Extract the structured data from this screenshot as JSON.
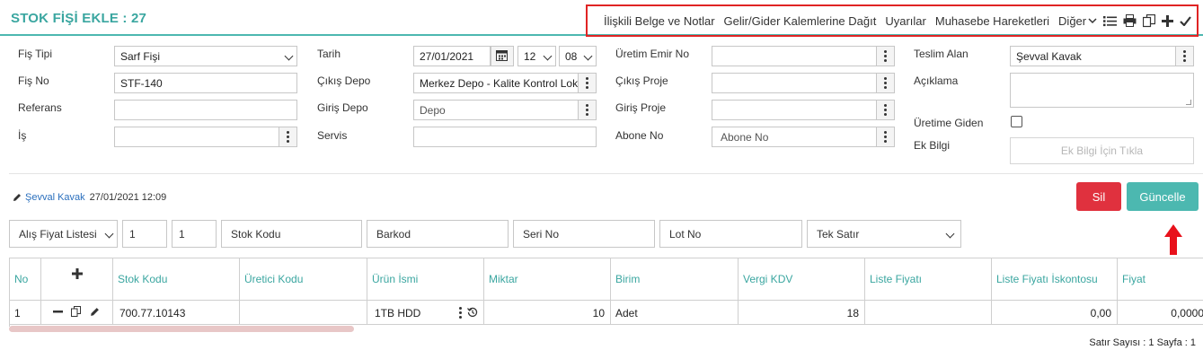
{
  "header": {
    "title": "STOK FİŞİ EKLE : 27",
    "menu": [
      "İlişkili Belge ve Notlar",
      "Gelir/Gider Kalemlerine Dağıt",
      "Uyarılar",
      "Muhasebe Hareketleri",
      "Diğer"
    ],
    "icons": [
      "chevron-down-icon",
      "list-icon",
      "print-icon",
      "copy-icon",
      "plus-icon",
      "check-icon"
    ]
  },
  "form": {
    "fis_tipi": {
      "label": "Fiş Tipi",
      "value": "Sarf Fişi"
    },
    "fis_no": {
      "label": "Fiş No",
      "value": "STF-140"
    },
    "referans": {
      "label": "Referans",
      "value": ""
    },
    "is": {
      "label": "İş",
      "value": ""
    },
    "tarih": {
      "label": "Tarih",
      "date": "27/01/2021",
      "hour": "12",
      "minute": "08"
    },
    "cikis_depo": {
      "label": "Çıkış Depo",
      "value": "Merkez Depo - Kalite Kontrol Lokasyonu"
    },
    "giris_depo": {
      "label": "Giriş Depo",
      "placeholder": "Depo"
    },
    "servis": {
      "label": "Servis",
      "value": ""
    },
    "uretim_emir_no": {
      "label": "Üretim Emir No",
      "value": ""
    },
    "cikis_proje": {
      "label": "Çıkış Proje",
      "value": ""
    },
    "giris_proje": {
      "label": "Giriş Proje",
      "value": ""
    },
    "abone_no": {
      "label": "Abone No",
      "placeholder": "Abone No"
    },
    "teslim_alan": {
      "label": "Teslim Alan",
      "value": "Şevval Kavak"
    },
    "aciklama": {
      "label": "Açıklama",
      "value": ""
    },
    "uretime_giden": {
      "label": "Üretime Giden",
      "checked": false
    },
    "ek_bilgi": {
      "label": "Ek Bilgi",
      "button": "Ek Bilgi İçin Tıkla"
    }
  },
  "meta": {
    "user": "Şevval Kavak",
    "timestamp": "27/01/2021 12:09"
  },
  "actions": {
    "delete": "Sil",
    "update": "Güncelle"
  },
  "filters": {
    "price_list": "Alış Fiyat Listesi",
    "qty1": "1",
    "qty2": "1",
    "stock_code": "Stok Kodu",
    "barcode": "Barkod",
    "serial_no": "Seri No",
    "lot_no": "Lot No",
    "mode": "Tek Satır"
  },
  "table": {
    "columns": [
      "No",
      "+",
      "Stok Kodu",
      "Üretici Kodu",
      "Ürün İsmi",
      "Miktar",
      "Birim",
      "Vergi KDV",
      "Liste Fiyatı",
      "Liste Fiyatı İskontosu",
      "Fiyat"
    ],
    "rows": [
      {
        "no": "1",
        "stock_code": "700.77.10143",
        "maker_code": "",
        "product": "1TB HDD",
        "qty": "10",
        "unit": "Adet",
        "vat": "18",
        "list_price": "",
        "list_discount": "0,00",
        "price": "0,0000"
      }
    ]
  },
  "footer": {
    "text": "Satır Sayısı : 1 Sayfa : 1"
  },
  "colors": {
    "accent": "#4cb8b0",
    "danger": "#e0313e",
    "highlight": "#e02424"
  }
}
